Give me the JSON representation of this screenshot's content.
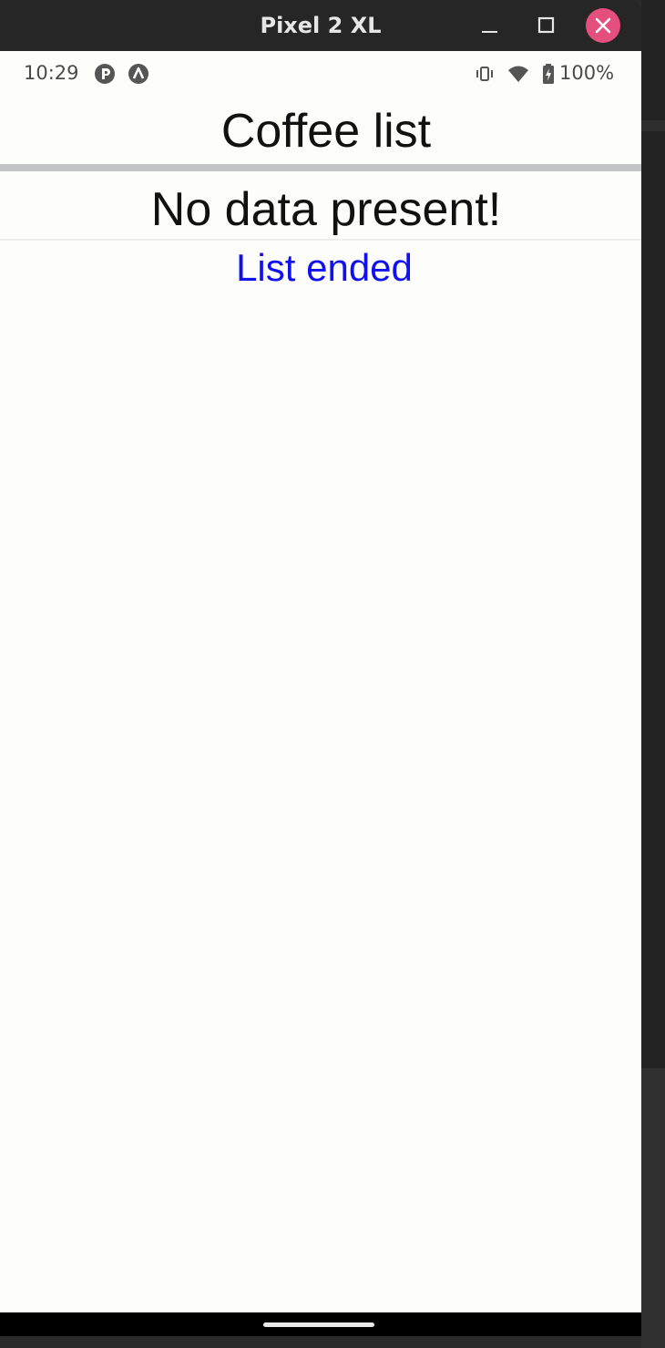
{
  "window": {
    "title": "Pixel 2 XL",
    "close_button_color": "#e54f7e"
  },
  "status_bar": {
    "time": "10:29",
    "battery": "100%",
    "icons": [
      "app-notification-icon",
      "android-notification-icon",
      "vibrate-icon",
      "wifi-icon",
      "battery-icon"
    ]
  },
  "app": {
    "title": "Coffee list",
    "empty_message": "No data present!",
    "footer": "List ended",
    "footer_color": "#1111ee"
  }
}
